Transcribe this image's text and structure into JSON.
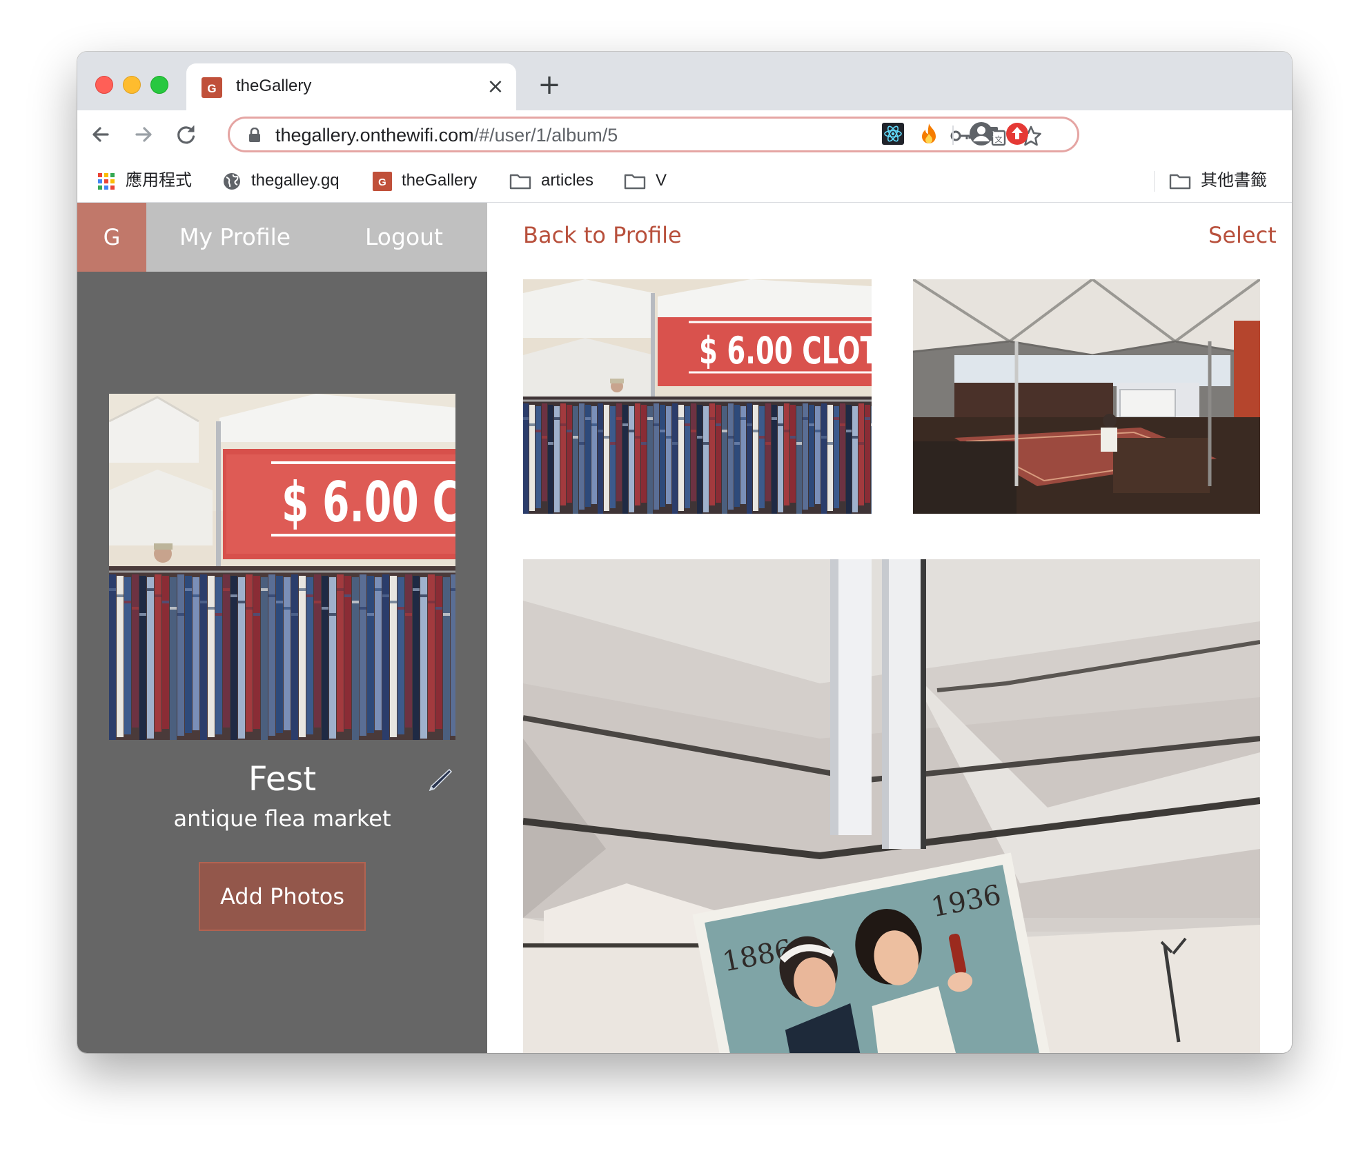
{
  "tab": {
    "favicon_letter": "G",
    "title": "theGallery",
    "close_glyph": "×",
    "new_tab_glyph": "+"
  },
  "toolbar": {
    "back_glyph": "←",
    "forward_glyph": "→",
    "reload_glyph": "↻",
    "url_host": "thegallery.onthewifi.com",
    "url_path": "/#/user/1/album/5",
    "omnibox_icons": [
      "lock-icon",
      "key-icon",
      "translate-icon",
      "star-icon"
    ],
    "extension_icons": [
      "react-devtools-icon",
      "fire-extension-icon",
      "profile-icon",
      "update-icon"
    ]
  },
  "bookmarks": {
    "items": [
      {
        "label": "應用程式",
        "icon": "apps-icon"
      },
      {
        "label": "thegalley.gq",
        "icon": "globe-icon"
      },
      {
        "label": "theGallery",
        "icon": "gallery-favicon-icon"
      },
      {
        "label": "articles",
        "icon": "folder-icon"
      },
      {
        "label": "V",
        "icon": "folder-icon"
      },
      {
        "label": "其他書籤",
        "icon": "folder-icon"
      }
    ]
  },
  "sidebar": {
    "logo": "G",
    "nav": {
      "profile": "My Profile",
      "logout": "Logout"
    },
    "album_title": "Fest",
    "album_description": "antique flea market",
    "add_photos_label": "Add Photos",
    "edit_icon": "pen-icon"
  },
  "main": {
    "back_label": "Back to Profile",
    "select_label": "Select",
    "photos": [
      {
        "name": "shirts-rack-photo",
        "sign_text": "$ 6.00 CLOT"
      },
      {
        "name": "rug-tent-photo"
      },
      {
        "name": "vintage-poster-photo",
        "poster_years": [
          "1886",
          "1936"
        ]
      }
    ],
    "cover_sign_text": "$ 6.00 C"
  },
  "colors": {
    "accent": "#b8503c",
    "sidebar_bg": "#666666",
    "nav_bg": "#c0c0c0",
    "logo_bg": "#c1786a",
    "button_bg": "#93574b",
    "omnibox_border": "#e5a5a3"
  }
}
